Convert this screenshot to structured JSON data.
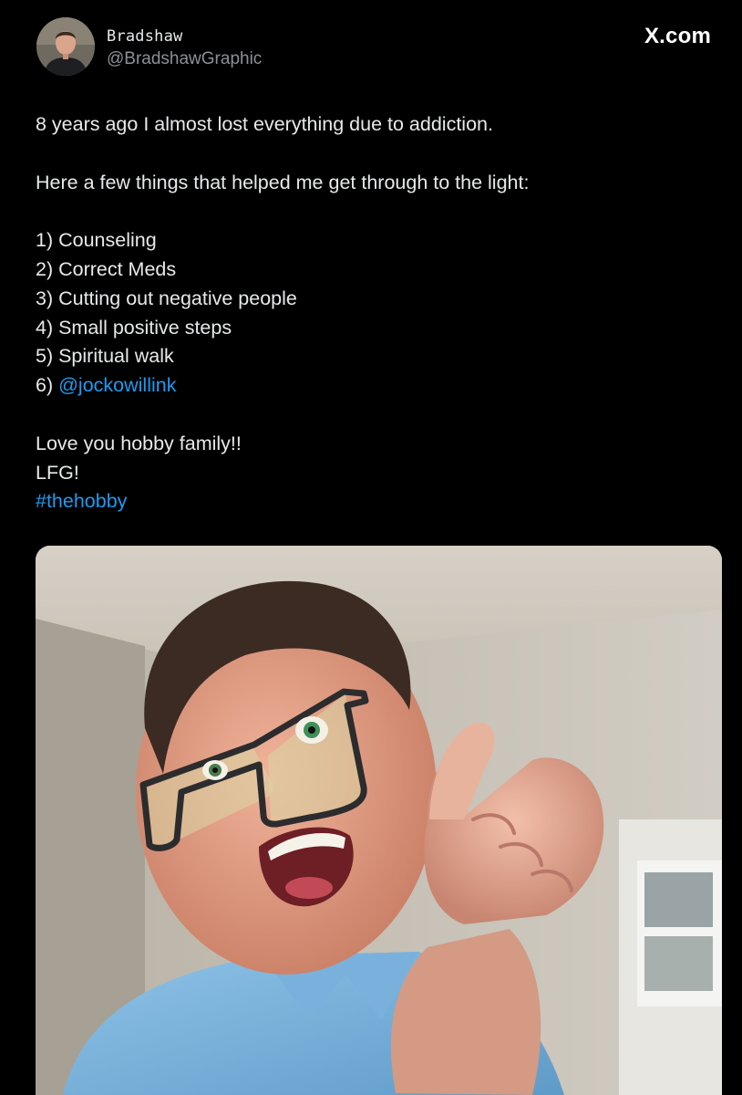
{
  "author": {
    "name": "Bradshaw",
    "handle": "@BradshawGraphic",
    "avatar_icon": "profile-photo-avatar"
  },
  "brand": {
    "label": "X.com"
  },
  "tweet": {
    "line1": "8 years ago I almost lost everything due to addiction.",
    "line2": "Here a few things that helped me get through to the light:",
    "list": [
      {
        "prefix": "1) ",
        "text": "Counseling"
      },
      {
        "prefix": "2) ",
        "text": "Correct Meds"
      },
      {
        "prefix": "3) ",
        "text": "Cutting out negative people"
      },
      {
        "prefix": "4) ",
        "text": "Small positive steps"
      },
      {
        "prefix": "5) ",
        "text": "Spiritual walk"
      },
      {
        "prefix": "6) ",
        "mention": "@jockowillink"
      }
    ],
    "closing1": "Love you hobby family!!",
    "closing2": "LFG!",
    "hashtag": "#thehobby"
  },
  "colors": {
    "background": "#000000",
    "text": "#e7e9ea",
    "secondary_text": "#8b9096",
    "link": "#1d9bf0"
  },
  "media": {
    "icon": "photo-man-glasses-pointing"
  }
}
